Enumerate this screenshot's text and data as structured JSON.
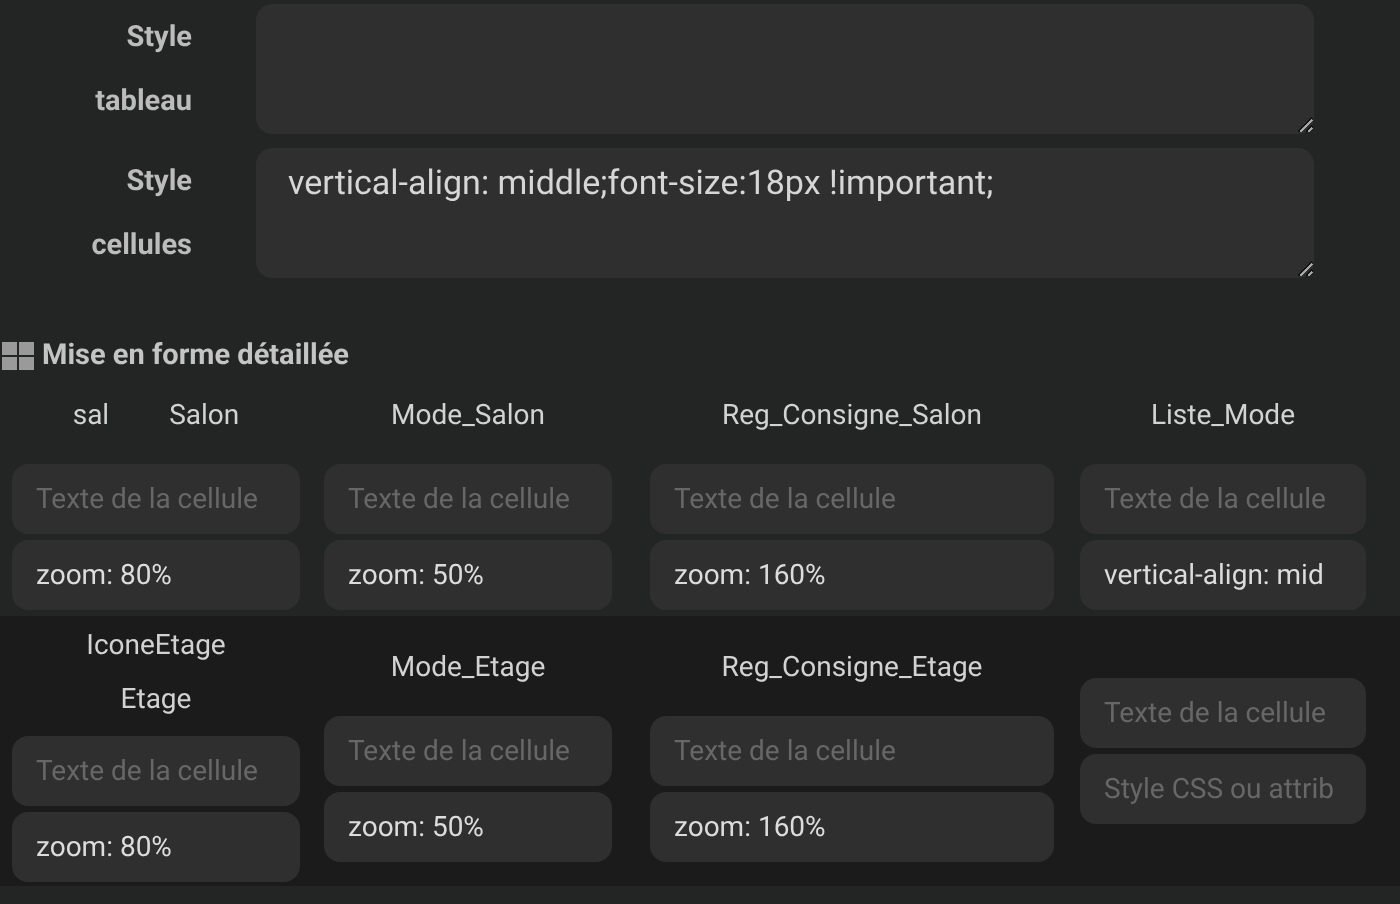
{
  "form": [
    {
      "label_lines": [
        "Style",
        "tableau"
      ]
    },
    {
      "label_lines": [
        "Style",
        "cellules"
      ],
      "value": "vertical-align: middle;font-size:18px !important;"
    }
  ],
  "section": {
    "title": "Mise en forme détaillée"
  },
  "rows": [
    {
      "cells": [
        {
          "header": {
            "kind": "inline",
            "parts": [
              "sal",
              "Salon"
            ]
          },
          "text_field": {
            "placeholder": "Texte de la cellule"
          },
          "style_field": {
            "value": "zoom: 80%"
          }
        },
        {
          "header": {
            "kind": "inline",
            "parts": [
              "Mode_Salon"
            ]
          },
          "text_field": {
            "placeholder": "Texte de la cellule"
          },
          "style_field": {
            "value": "zoom: 50%"
          }
        },
        {
          "header": {
            "kind": "inline",
            "parts": [
              "Reg_Consigne_Salon"
            ]
          },
          "text_field": {
            "placeholder": "Texte de la cellule"
          },
          "style_field": {
            "value": "zoom: 160%"
          }
        },
        {
          "header": {
            "kind": "inline",
            "parts": [
              "Liste_Mode"
            ]
          },
          "text_field": {
            "placeholder": "Texte de la cellule"
          },
          "style_field": {
            "value": "vertical-align: mid"
          }
        }
      ]
    },
    {
      "cells": [
        {
          "header": {
            "kind": "stacked",
            "parts": [
              "IconeEtage",
              "Etage"
            ]
          },
          "text_field": {
            "placeholder": "Texte de la cellule"
          },
          "style_field": {
            "value": "zoom: 80%"
          }
        },
        {
          "header": {
            "kind": "inline",
            "parts": [
              "Mode_Etage"
            ]
          },
          "text_field": {
            "placeholder": "Texte de la cellule"
          },
          "style_field": {
            "value": "zoom: 50%"
          }
        },
        {
          "header": {
            "kind": "inline",
            "parts": [
              "Reg_Consigne_Etage"
            ]
          },
          "text_field": {
            "placeholder": "Texte de la cellule"
          },
          "style_field": {
            "value": "zoom: 160%"
          }
        },
        {
          "text_field": {
            "placeholder": "Texte de la cellule"
          },
          "style_field": {
            "placeholder": "Style CSS ou attrib"
          }
        }
      ]
    }
  ]
}
